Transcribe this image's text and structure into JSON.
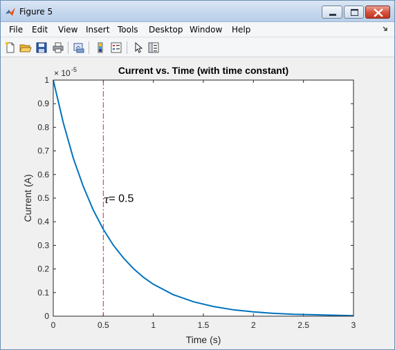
{
  "window": {
    "title": "Figure 5"
  },
  "menu": [
    "File",
    "Edit",
    "View",
    "Insert",
    "Tools",
    "Desktop",
    "Window",
    "Help"
  ],
  "toolbar": [
    {
      "name": "new-figure-icon"
    },
    {
      "name": "open-file-icon"
    },
    {
      "name": "save-icon"
    },
    {
      "name": "print-icon"
    },
    {
      "name": "link-plot-icon"
    },
    {
      "name": "colorbar-icon"
    },
    {
      "name": "legend-icon"
    },
    {
      "name": "edit-plot-arrow-icon"
    },
    {
      "name": "property-inspector-icon"
    }
  ],
  "chart_data": {
    "type": "line",
    "title": "Current vs. Time (with time constant)",
    "xlabel": "Time (s)",
    "ylabel": "Current (A)",
    "exponent_label": "× 10",
    "exponent_power": "-5",
    "xlim": [
      0,
      3
    ],
    "ylim": [
      0,
      1
    ],
    "x_ticks": [
      "0",
      "0.5",
      "1",
      "1.5",
      "2",
      "2.5",
      "3"
    ],
    "y_ticks": [
      "0",
      "0.1",
      "0.2",
      "0.3",
      "0.4",
      "0.5",
      "0.6",
      "0.7",
      "0.8",
      "0.9",
      "1"
    ],
    "series": [
      {
        "color": "#0072bd",
        "x": [
          0,
          0.1,
          0.2,
          0.3,
          0.4,
          0.5,
          0.6,
          0.7,
          0.8,
          0.9,
          1.0,
          1.2,
          1.4,
          1.6,
          1.8,
          2.0,
          2.2,
          2.4,
          2.6,
          2.8,
          3.0
        ],
        "y": [
          1.0,
          0.819,
          0.67,
          0.549,
          0.449,
          0.368,
          0.301,
          0.247,
          0.202,
          0.165,
          0.135,
          0.091,
          0.061,
          0.041,
          0.027,
          0.018,
          0.012,
          0.008,
          0.006,
          0.004,
          0.002
        ]
      }
    ],
    "vline": {
      "x": 0.5,
      "color": "#d62728",
      "style": "dash-dot"
    },
    "annotation": {
      "symbol": "τ",
      "text": " = 0.5",
      "x": 0.5,
      "y": 0.49
    },
    "grid": false
  }
}
